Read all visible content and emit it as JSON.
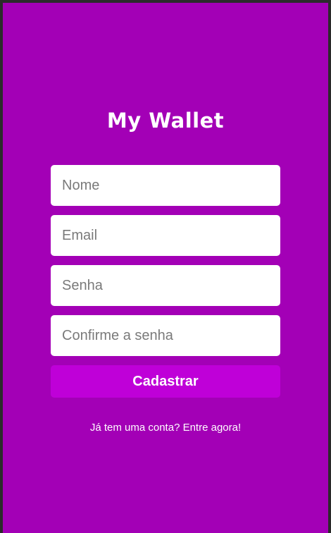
{
  "app": {
    "title": "My Wallet"
  },
  "form": {
    "name_placeholder": "Nome",
    "email_placeholder": "Email",
    "password_placeholder": "Senha",
    "confirm_placeholder": "Confirme a senha",
    "submit_label": "Cadastrar"
  },
  "footer": {
    "login_link": "Já tem uma conta? Entre agora!"
  },
  "colors": {
    "background": "#a300b6",
    "button": "#bf00d8",
    "text": "#ffffff"
  }
}
